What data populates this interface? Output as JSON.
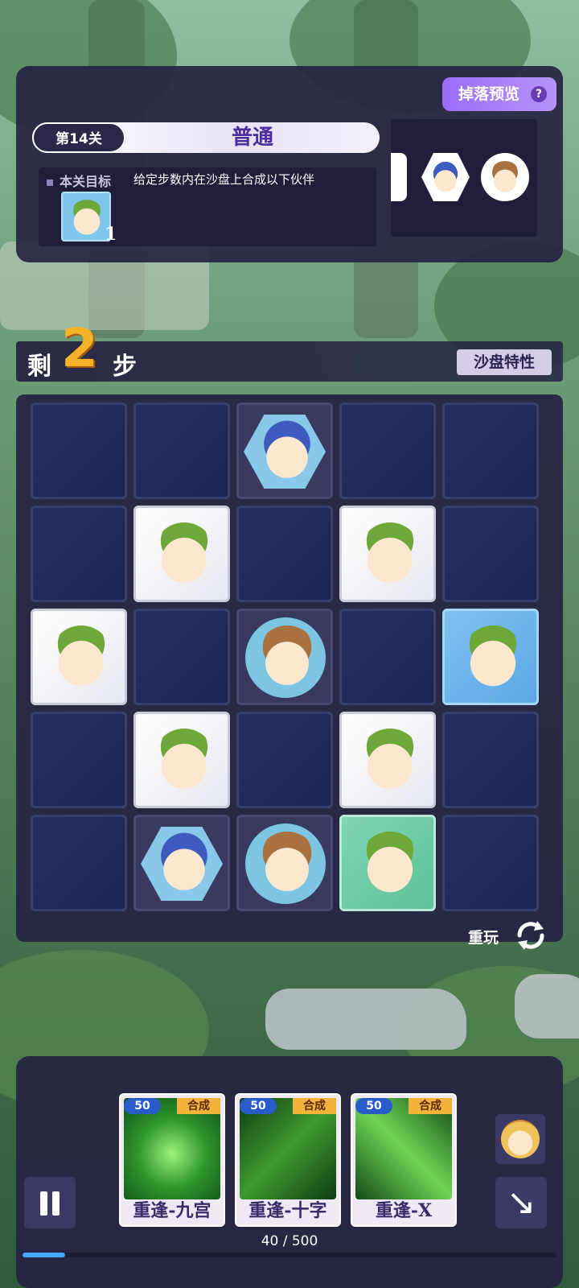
{
  "level": {
    "number_label": "第14关",
    "difficulty": "普通",
    "goal_title": "本关目标",
    "goal_desc": "给定步数内在沙盘上合成以下伙伴",
    "goal_count": "1",
    "drop_preview_label": "掉落预览",
    "help_icon": "?"
  },
  "steps": {
    "prefix": "剩",
    "count": "2",
    "suffix": "步",
    "sand_feature_label": "沙盘特性"
  },
  "board": {
    "rows": [
      [
        "empty",
        "empty",
        "orange-hex",
        "empty",
        "empty"
      ],
      [
        "empty",
        "elf-white",
        "empty",
        "elf-white",
        "empty"
      ],
      [
        "elf-white",
        "empty",
        "cat-circle",
        "empty",
        "elf-ice"
      ],
      [
        "empty",
        "elf-white",
        "empty",
        "elf-white",
        "empty"
      ],
      [
        "empty",
        "orange-hex",
        "cat-circle",
        "elf-green",
        "empty"
      ]
    ]
  },
  "replay_label": "重玩",
  "skills": [
    {
      "cost": "50",
      "tag": "合成",
      "name": "重逢-九宫"
    },
    {
      "cost": "50",
      "tag": "合成",
      "name": "重逢-十字"
    },
    {
      "cost": "50",
      "tag": "合成",
      "name": "重逢-X"
    }
  ],
  "energy": {
    "text": "40 / 500",
    "fraction": 0.08
  },
  "icons": {
    "pause": "pause-icon",
    "replay": "replay-icon",
    "arrow": "arrow-down-right-icon"
  }
}
